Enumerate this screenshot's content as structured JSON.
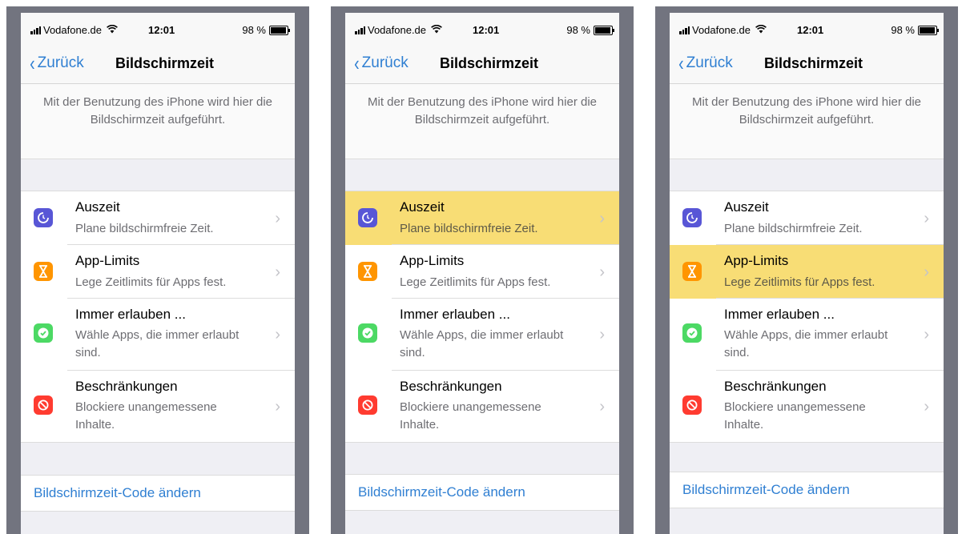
{
  "status_bar": {
    "carrier": "Vodafone.de",
    "wifi_icon": "wifi-icon",
    "time": "12:01",
    "battery": "98 %"
  },
  "nav": {
    "back_label": "Zurück",
    "title": "Bildschirmzeit"
  },
  "info_text": "Mit der Benutzung des iPhone wird hier die Bildschirmzeit aufgeführt.",
  "items": [
    {
      "title": "Auszeit",
      "subtitle": "Plane bildschirmfreie Zeit.",
      "icon": "downtime-icon",
      "color": "#5856d6"
    },
    {
      "title": "App-Limits",
      "subtitle": "Lege Zeitlimits für Apps fest.",
      "icon": "hourglass-icon",
      "color": "#ff9500"
    },
    {
      "title": "Immer erlauben ...",
      "subtitle": "Wähle Apps, die immer erlaubt sind.",
      "icon": "checkmark-badge-icon",
      "color": "#4cd964"
    },
    {
      "title": "Beschränkungen",
      "subtitle": "Blockiere unangemessene Inhalte.",
      "icon": "restriction-icon",
      "color": "#ff3b30"
    }
  ],
  "chevron": "›",
  "code_button": "Bildschirmzeit-Code ändern",
  "panels": [
    {
      "highlighted_item": null
    },
    {
      "highlighted_item": "Auszeit"
    },
    {
      "highlighted_item": "App-Limits"
    }
  ],
  "colors": {
    "accent": "#2f7fd2",
    "highlight": "#f8dd75",
    "background": "#efeff4",
    "frame": "#72747f"
  }
}
